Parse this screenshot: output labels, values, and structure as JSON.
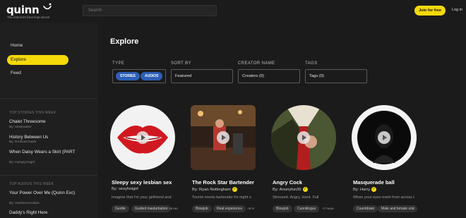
{
  "brand": {
    "logo": "quinn",
    "tagline": "The internet's best kept secret"
  },
  "search": {
    "placeholder": "Search"
  },
  "header": {
    "join_label": "Join for free",
    "login_label": "Log in"
  },
  "sidebar": {
    "nav": [
      {
        "label": "Home"
      },
      {
        "label": "Explore",
        "active": true
      },
      {
        "label": "Feed"
      }
    ],
    "top_stories_heading": "TOP STORIES THIS WEEK",
    "top_stories": [
      {
        "title": "Chalet Threesome",
        "by": "By: sextmaster"
      },
      {
        "title": "History Between Us",
        "by": "By: EroticaCouple"
      },
      {
        "title": "When Daisy Wears a Skirt (PART",
        "by": "By: HungryAngel"
      }
    ],
    "top_audios_heading": "TOP AUDIOS THIS WEEK",
    "top_audios": [
      {
        "title": "Your Power Over Me (Quinn Exc)",
        "by": "By: GeeforceAudios"
      },
      {
        "title": "Daddy's Right Here",
        "by": ""
      }
    ]
  },
  "main": {
    "title": "Explore",
    "filters": {
      "type_label": "TYPE",
      "type_options": [
        "STORIES",
        "AUDIOS"
      ],
      "sort_label": "SORT BY",
      "sort_value": "Featured",
      "creator_label": "CREATOR NAME",
      "creator_value": "Creators (0)",
      "tags_label": "TAGS",
      "tags_value": "Tags (0)"
    },
    "cards": [
      {
        "title": "Sleepy sexy lesbian sex",
        "by": "By: sexyhotgirl",
        "verified": false,
        "desc": "Imagine that I'm your girlfriend and",
        "tags": [
          "Gentle",
          "Guided masturbation"
        ],
        "more": "+5 mo"
      },
      {
        "title": "The Rock Star Bartender",
        "by": "By: Ryan-Nottingham",
        "verified": true,
        "desc": "Tourist meets bartender for night o",
        "tags": [
          "Blowjob",
          "Real experience"
        ],
        "more": "+5 m"
      },
      {
        "title": "Angry Cock",
        "by": "By: Anonyfun35",
        "verified": true,
        "desc": "Stressed. Angry. Hard. Full",
        "tags": [
          "Blowjob",
          "Cunnilingus"
        ],
        "more": "+7 more"
      },
      {
        "title": "Masquerade ball",
        "by": "By: Harry",
        "verified": true,
        "desc": "When your eyes meet from across t",
        "tags": [
          "Countdown",
          "Male and female voic"
        ],
        "more": ""
      }
    ]
  },
  "colors": {
    "accent": "#f5d90a",
    "pill_blue": "#2d5fb8",
    "background": "#1b1b1b"
  }
}
